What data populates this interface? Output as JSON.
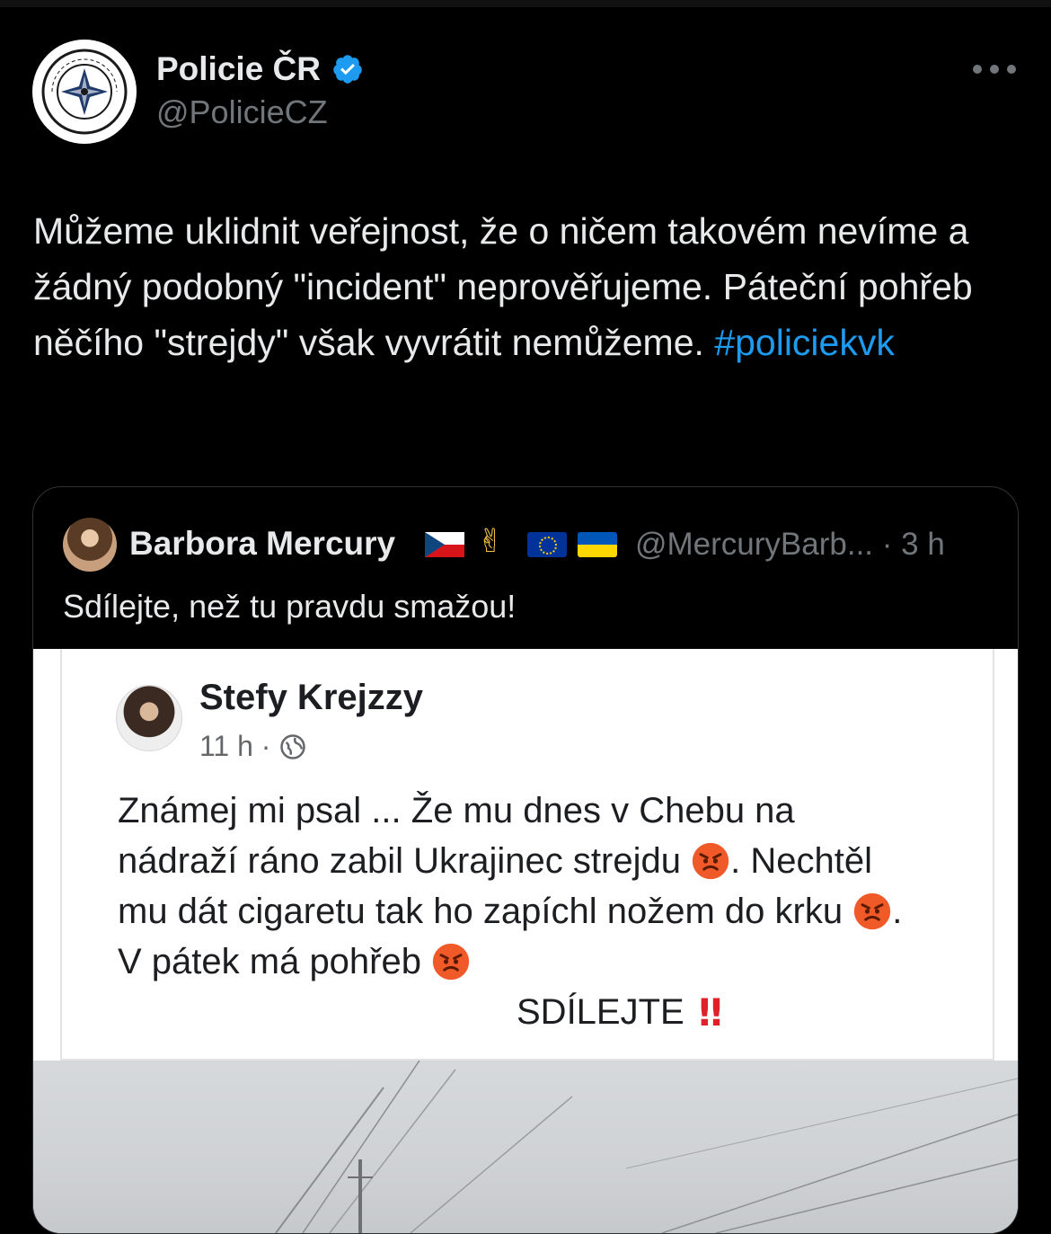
{
  "tweet": {
    "display_name": "Policie ČR",
    "handle": "@PolicieCZ",
    "verified": true,
    "avatar_icon": "police-cr-logo-icon",
    "text_main": "Můžeme uklidnit veřejnost, že o ničem takovém nevíme a žádný podobný \"incident\" neprověřujeme. Páteční pohřeb něčího \"strejdy\" však vyvrátit nemůžeme.",
    "hashtag": "#policiekvk",
    "colors": {
      "background": "#000000",
      "text": "#e7e9ea",
      "secondary": "#71767b",
      "accent": "#1d9bf0"
    }
  },
  "quoted": {
    "display_name": "Barbora Mercury",
    "name_emojis": [
      "cz-flag",
      "victory-hand",
      "eu-flag",
      "ua-flag"
    ],
    "handle_time": "@MercuryBarb... · 3 h",
    "text": "Sdílejte, než tu pravdu smažou!",
    "embedded_post": {
      "author": "Stefy Krejzzy",
      "time": "11 h ·",
      "line1": "Známej mi psal ...  Že mu dnes v Chebu na",
      "line2a": "nádraží ráno zabil Ukrajinec strejdu",
      "line2b": ". Nechtěl",
      "line3a": "mu dát cigaretu tak ho zapíchl nožem do krku",
      "line3b": ".",
      "line4": "V pátek má pohřeb",
      "share_text": "SDÍLEJTE",
      "share_mark": "‼"
    }
  }
}
